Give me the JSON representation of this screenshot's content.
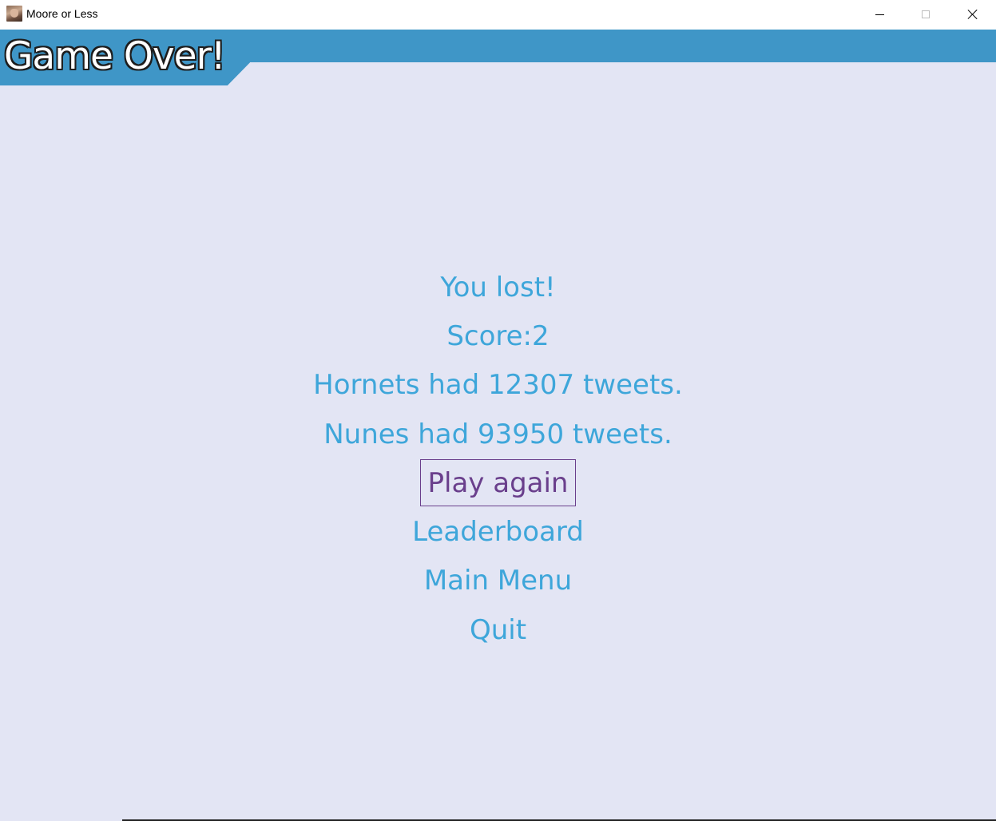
{
  "window": {
    "title": "Moore or Less",
    "app_icon": "portrait-icon",
    "controls": [
      "minimize-icon",
      "maximize-icon",
      "close-icon"
    ]
  },
  "header": {
    "title": "Game Over!",
    "band_color": "#3f96c7"
  },
  "result": {
    "message": "You lost!",
    "score": "Score:2",
    "fact_1": "Hornets had 12307 tweets.",
    "fact_2": "Nunes had 93950 tweets."
  },
  "menu": {
    "play_again": "Play again",
    "leaderboard": "Leaderboard",
    "main_menu": "Main Menu",
    "quit": "Quit",
    "selected": "Play again"
  },
  "colors": {
    "background": "#e3e5f4",
    "text": "#3ea6da",
    "selected": "#6a3f8c"
  }
}
